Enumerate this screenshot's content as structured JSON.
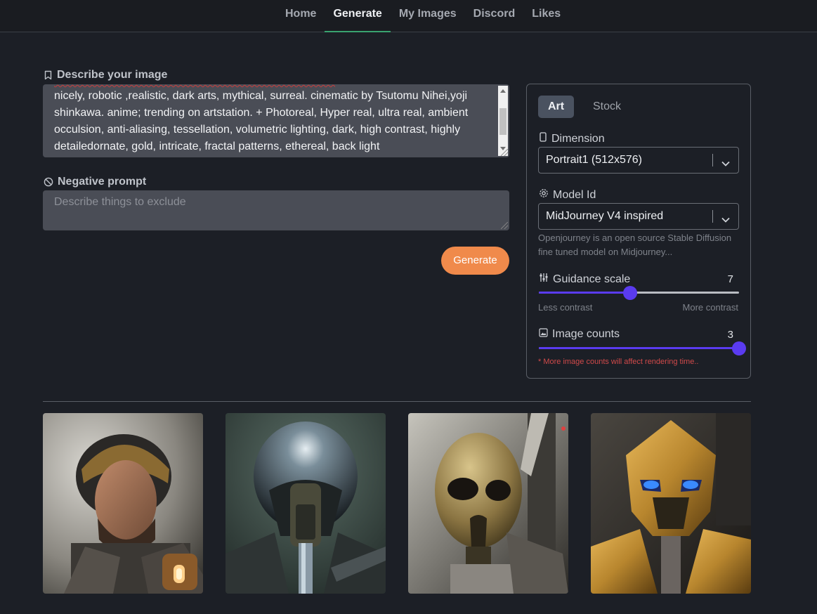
{
  "nav": {
    "items": [
      "Home",
      "Generate",
      "My Images",
      "Discord",
      "Likes"
    ],
    "active": "Generate"
  },
  "prompt": {
    "label": "Describe your image",
    "lines": [
      "nicely, robotic ,realistic, dark arts, mythical, surreal. cinematic by Tsutomu Nihei,yoji",
      "shinkawa. anime; trending on artstation. + Photoreal, Hyper real, ultra real, ambient",
      "occulsion, anti-aliasing, tessellation, volumetric lighting, dark, high contrast, highly",
      "detailedornate, gold, intricate, fractal patterns, ethereal, back light"
    ]
  },
  "negative": {
    "label": "Negative prompt",
    "placeholder": "Describe things to exclude"
  },
  "generate_label": "Generate",
  "panel": {
    "tabs": [
      "Art",
      "Stock"
    ],
    "active_tab": "Art",
    "dimension": {
      "label": "Dimension",
      "value": "Portrait1 (512x576)"
    },
    "model": {
      "label": "Model Id",
      "value": "MidJourney V4 inspired",
      "description": "Openjourney is an open source Stable Diffusion fine tuned model on Midjourney..."
    },
    "guidance": {
      "label": "Guidance scale",
      "value": "7",
      "level": 0.455,
      "min_label": "Less contrast",
      "max_label": "More contrast"
    },
    "counts": {
      "label": "Image counts",
      "value": "3",
      "level": 1.0,
      "warning": "* More image counts will affect rendering time.."
    }
  },
  "images": [
    {
      "subject": "armored-soldier-portrait"
    },
    {
      "subject": "chrome-helmet-robot"
    },
    {
      "subject": "gold-skull-robot"
    },
    {
      "subject": "gold-armored-robot-blue-eyes"
    }
  ],
  "colors": {
    "accent": "#5a3bf0",
    "generate": "#f08a4b",
    "active_underline": "#3aa36f",
    "warning": "#d14a4a"
  }
}
